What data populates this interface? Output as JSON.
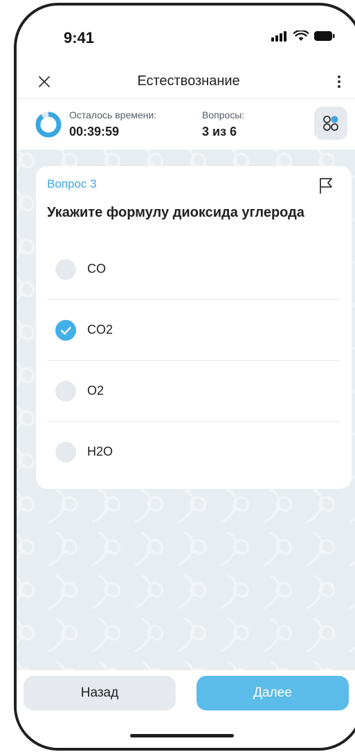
{
  "status_bar": {
    "time": "9:41"
  },
  "header": {
    "title": "Естествознание",
    "close_icon": "close-icon",
    "menu_icon": "more-vertical-icon"
  },
  "info": {
    "time_label": "Осталось времени:",
    "time_value": "00:39:59",
    "questions_label": "Вопросы:",
    "questions_value": "3 из 6",
    "timer_progress": 0.9
  },
  "question": {
    "number_label": "Вопрос 3",
    "text": "Укажите формулу диоксида углерода",
    "options": [
      {
        "label": "CO",
        "checked": false
      },
      {
        "label": "CO2",
        "checked": true
      },
      {
        "label": "O2",
        "checked": false
      },
      {
        "label": "H2O",
        "checked": false
      }
    ]
  },
  "footer": {
    "back_label": "Назад",
    "next_label": "Далее"
  },
  "colors": {
    "accent": "#44aee8",
    "next_button": "#5bbbe9",
    "background": "#e8edf1"
  }
}
